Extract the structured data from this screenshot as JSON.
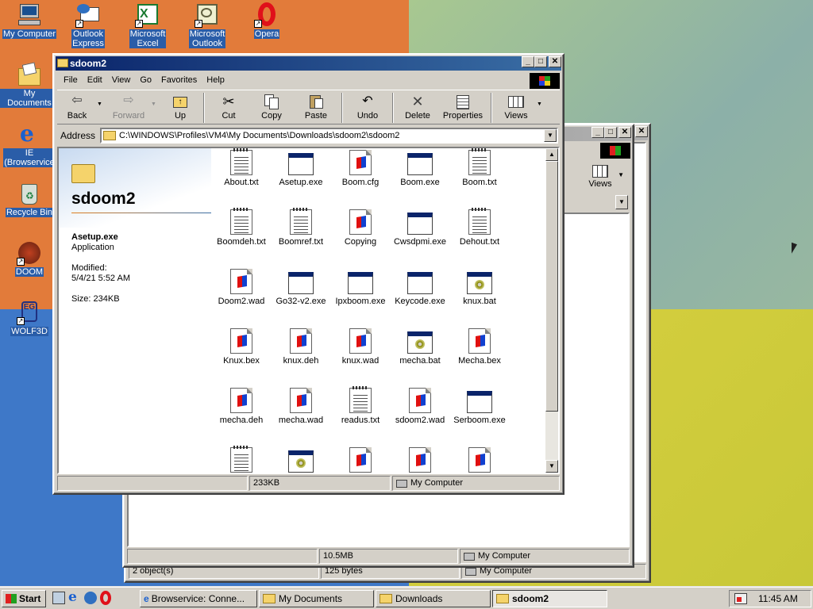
{
  "desktop_icons": [
    {
      "label_lines": [
        "My Computer"
      ]
    },
    {
      "label_lines": [
        "Outlook",
        "Express"
      ]
    },
    {
      "label_lines": [
        "Microsoft",
        "Excel"
      ]
    },
    {
      "label_lines": [
        "Microsoft",
        "Outlook"
      ]
    },
    {
      "label_lines": [
        "Opera"
      ]
    },
    {
      "label_lines": [
        "My Documents"
      ]
    },
    {
      "label_lines": [
        "IE",
        "(Browservice"
      ]
    },
    {
      "label_lines": [
        "Recycle Bin"
      ]
    },
    {
      "label_lines": [
        "DOOM"
      ]
    },
    {
      "label_lines": [
        "WOLF3D"
      ]
    }
  ],
  "back_window": {
    "views_label": "Views",
    "status_size": "10.5MB",
    "status_zone": "My Computer"
  },
  "back_window2": {
    "status_objects": "2 object(s)",
    "status_size": "125 bytes",
    "status_zone": "My Computer"
  },
  "main_window": {
    "title": "sdoom2",
    "menu": [
      "File",
      "Edit",
      "View",
      "Go",
      "Favorites",
      "Help"
    ],
    "toolbar": {
      "back": "Back",
      "forward": "Forward",
      "up": "Up",
      "cut": "Cut",
      "copy": "Copy",
      "paste": "Paste",
      "undo": "Undo",
      "delete": "Delete",
      "properties": "Properties",
      "views": "Views"
    },
    "address_label": "Address",
    "address_value": "C:\\WINDOWS\\Profiles\\VM4\\My Documents\\Downloads\\sdoom2\\sdoom2",
    "info_panel": {
      "folder_name": "sdoom2",
      "selected_name": "Asetup.exe",
      "selected_type": "Application",
      "modified_label": "Modified:",
      "modified_value": "5/4/21 5:52 AM",
      "size": "Size: 234KB"
    },
    "files": [
      {
        "name": "About.txt",
        "icon": "text-file-icon"
      },
      {
        "name": "Asetup.exe",
        "icon": "application-icon"
      },
      {
        "name": "Boom.cfg",
        "icon": "doom-file-icon"
      },
      {
        "name": "Boom.exe",
        "icon": "application-icon"
      },
      {
        "name": "Boom.txt",
        "icon": "text-file-icon"
      },
      {
        "name": "Boomdeh.txt",
        "icon": "text-file-icon"
      },
      {
        "name": "Boomref.txt",
        "icon": "text-file-icon"
      },
      {
        "name": "Copying",
        "icon": "doom-file-icon"
      },
      {
        "name": "Cwsdpmi.exe",
        "icon": "application-icon"
      },
      {
        "name": "Dehout.txt",
        "icon": "text-file-icon"
      },
      {
        "name": "Doom2.wad",
        "icon": "doom-file-icon"
      },
      {
        "name": "Go32-v2.exe",
        "icon": "application-icon"
      },
      {
        "name": "Ipxboom.exe",
        "icon": "application-icon"
      },
      {
        "name": "Keycode.exe",
        "icon": "application-icon"
      },
      {
        "name": "knux.bat",
        "icon": "batch-file-icon"
      },
      {
        "name": "Knux.bex",
        "icon": "doom-file-icon"
      },
      {
        "name": "knux.deh",
        "icon": "doom-file-icon"
      },
      {
        "name": "knux.wad",
        "icon": "doom-file-icon"
      },
      {
        "name": "mecha.bat",
        "icon": "batch-file-icon"
      },
      {
        "name": "Mecha.bex",
        "icon": "doom-file-icon"
      },
      {
        "name": "mecha.deh",
        "icon": "doom-file-icon"
      },
      {
        "name": "mecha.wad",
        "icon": "doom-file-icon"
      },
      {
        "name": "readus.txt",
        "icon": "text-file-icon"
      },
      {
        "name": "sdoom2.wad",
        "icon": "doom-file-icon"
      },
      {
        "name": "Serboom.exe",
        "icon": "application-icon"
      },
      {
        "name": "",
        "icon": "text-file-icon"
      },
      {
        "name": "",
        "icon": "batch-file-icon"
      },
      {
        "name": "",
        "icon": "doom-file-icon"
      },
      {
        "name": "",
        "icon": "doom-file-icon"
      },
      {
        "name": "",
        "icon": "doom-file-icon"
      }
    ],
    "status_size": "233KB",
    "status_zone": "My Computer"
  },
  "taskbar": {
    "start_label": "Start",
    "buttons": [
      "Browservice: Conne...",
      "My Documents",
      "Downloads",
      "sdoom2"
    ],
    "clock": "11:45 AM"
  }
}
